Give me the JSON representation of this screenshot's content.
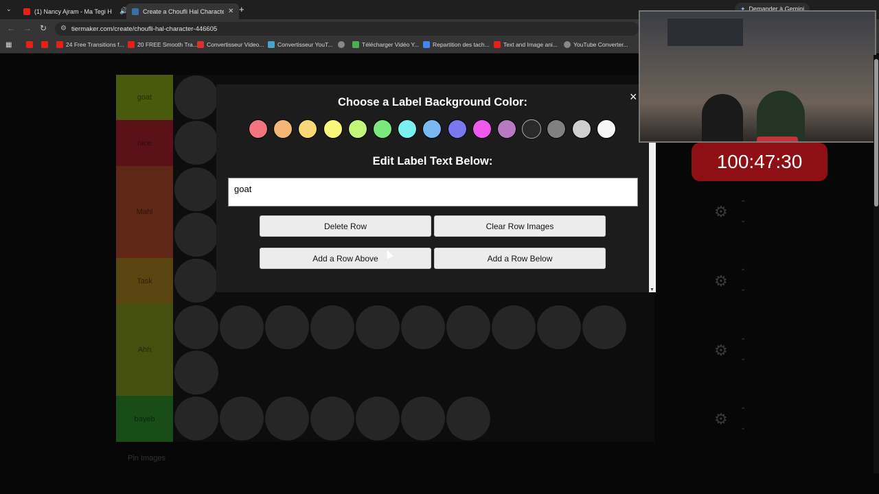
{
  "browser": {
    "tabs": [
      {
        "label": "(1) Nancy Ajram - Ma Tegi H",
        "favicon_color": "#e62117"
      },
      {
        "label": "Create a Choufli Hal Character",
        "favicon_color": "#3a6ea5"
      }
    ],
    "url": "tiermaker.com/create/choufli-hal-character-446605",
    "gemini_button": "Demander à Gemini",
    "bookmarks": [
      "24 Free Transitions f...",
      "20 FREE Smooth Tra...",
      "Convertisseur Video...",
      "Convertisseur YouT...",
      "Télécharger Vidéo Y...",
      "Repartition des tach...",
      "Text and Image ani...",
      "YouTube Converter..."
    ]
  },
  "tier_rows": [
    {
      "label": "goat",
      "color": "#7a8f12"
    },
    {
      "label": "nice",
      "color": "#a3202c"
    },
    {
      "label": "Mahi",
      "color": "#a84427"
    },
    {
      "label": "Task",
      "color": "#a07a1e"
    },
    {
      "label": "Ahh",
      "color": "#7b8f1c"
    },
    {
      "label": "bayeb",
      "color": "#2b8a2b"
    }
  ],
  "pin_images_label": "Pin Images",
  "modal": {
    "color_heading": "Choose a Label Background Color:",
    "text_heading": "Edit Label Text Below:",
    "label_text": "goat",
    "close_symbol": "×",
    "swatches": [
      "#f0757d",
      "#f5b577",
      "#f7d877",
      "#f9f67a",
      "#c2f57a",
      "#7ae87a",
      "#7af0f0",
      "#7ab8f2",
      "#7a78ee",
      "#ee5aee",
      "#b878c2",
      "#2a2a2a",
      "#808080",
      "#cfcfcf",
      "#f7f7f7"
    ],
    "buttons": {
      "delete_row": "Delete Row",
      "clear_row_images": "Clear Row Images",
      "add_row_above": "Add a Row Above",
      "add_row_below": "Add a Row Below"
    }
  },
  "stream_overlay": {
    "timer": "100:47:30"
  }
}
